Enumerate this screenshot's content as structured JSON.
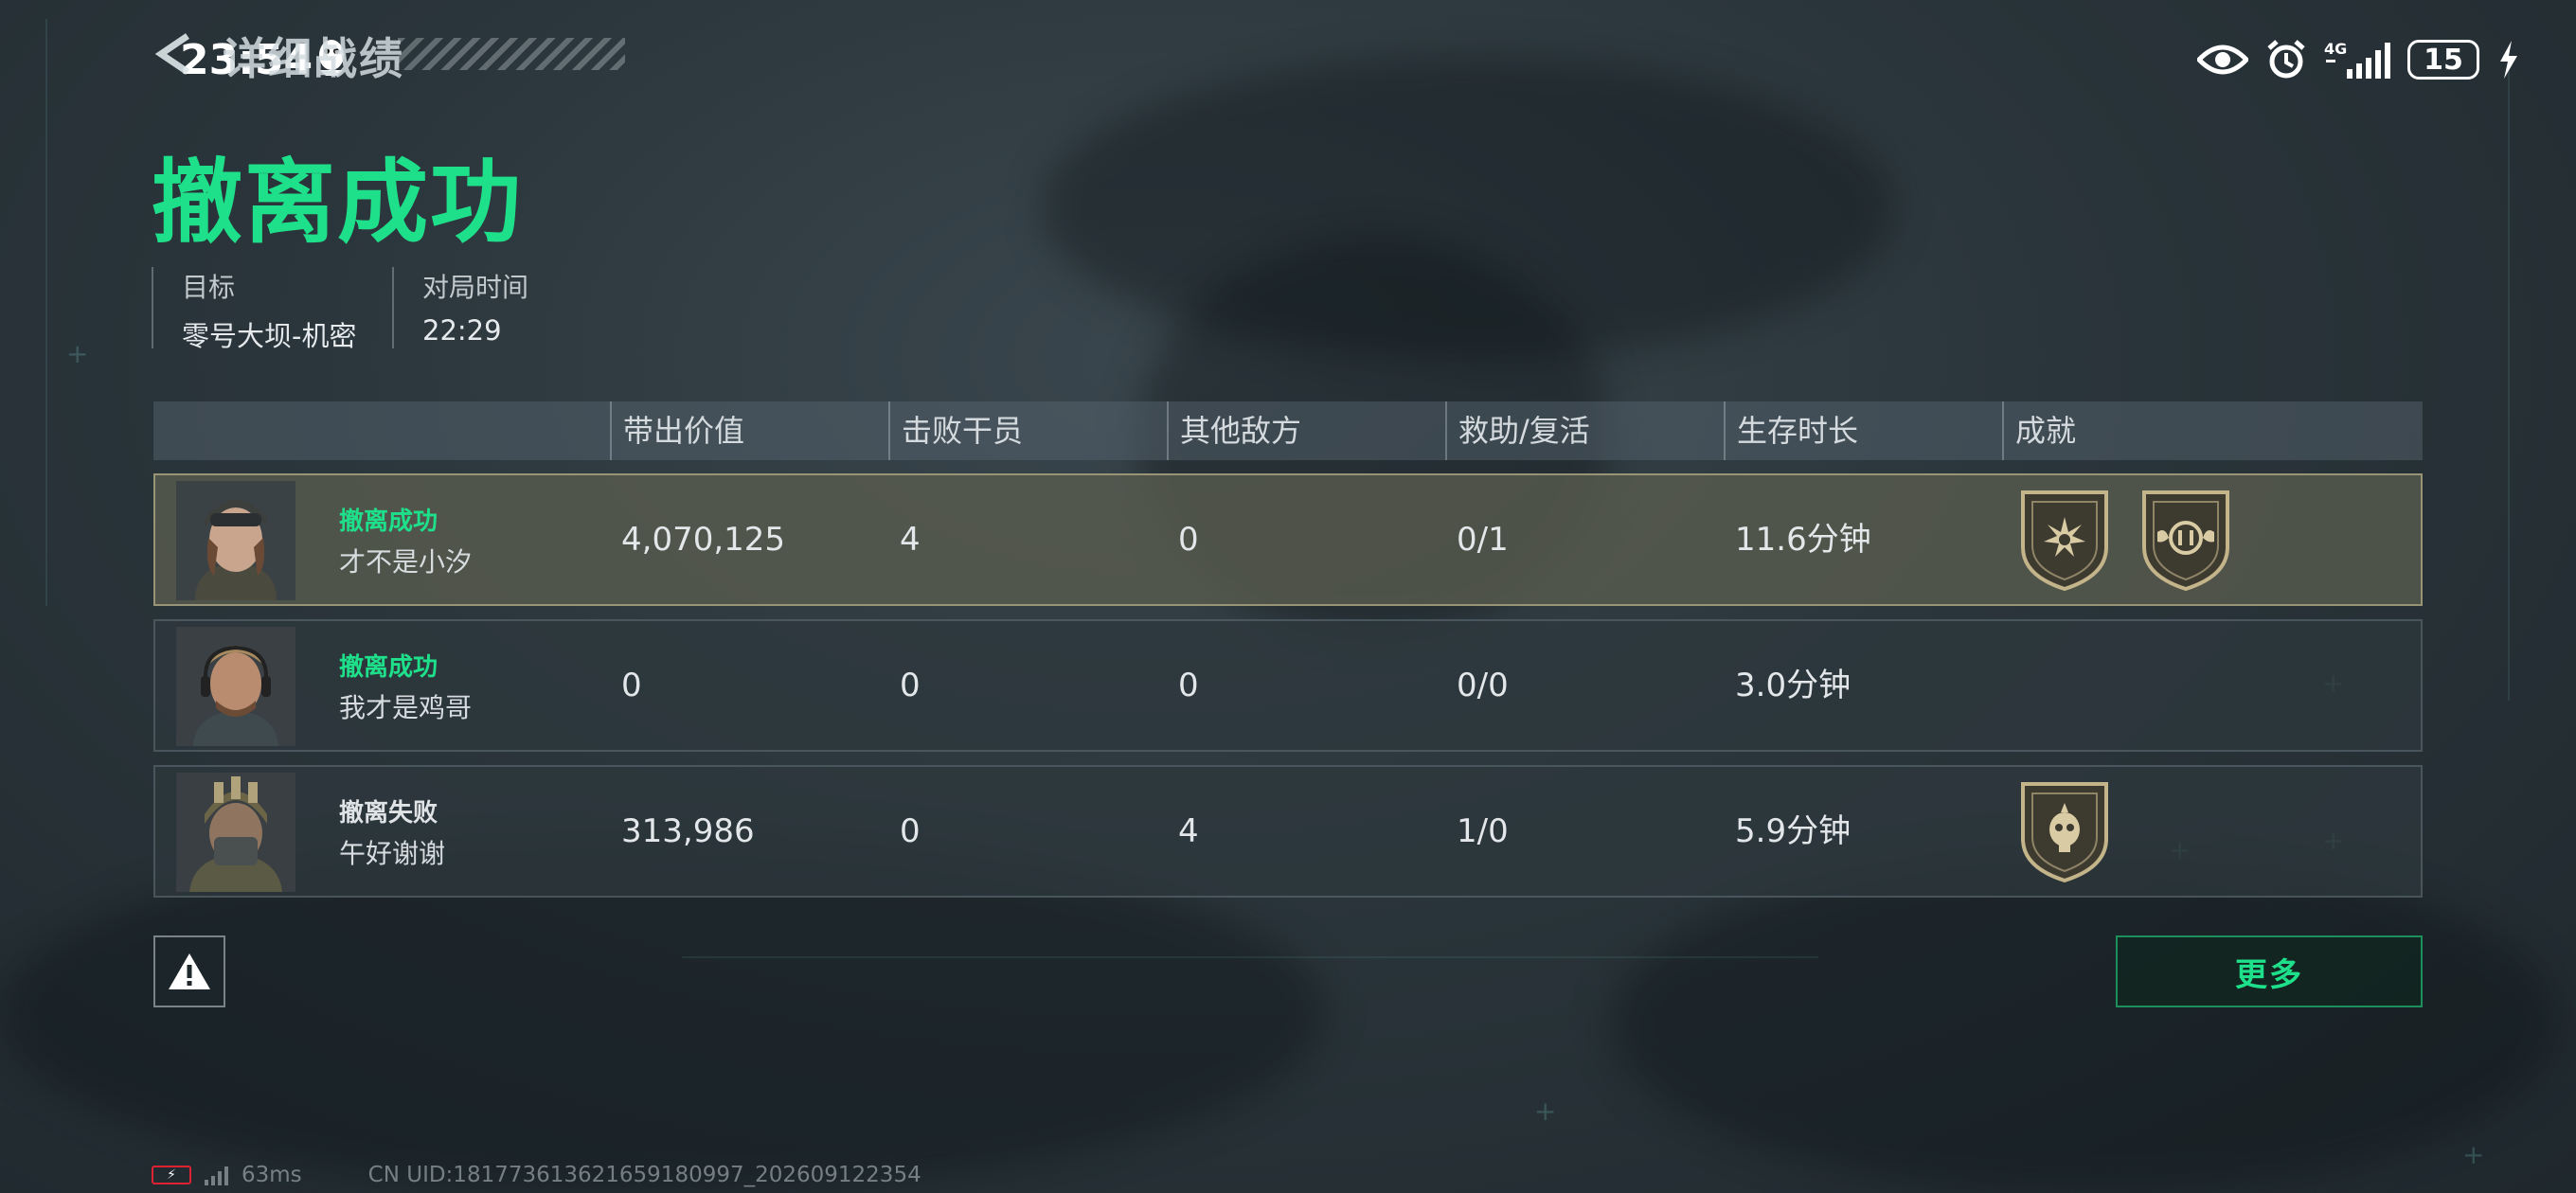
{
  "status_bar": {
    "time": "23:54",
    "battery_level": "15"
  },
  "header": {
    "back_label": "详细战绩",
    "result_title": "撤离成功"
  },
  "info": {
    "target_label": "目标",
    "target_value": "零号大坝-机密",
    "match_time_label": "对局时间",
    "match_time_value": "22:29"
  },
  "table": {
    "columns": [
      "带出价值",
      "击败干员",
      "其他敌方",
      "救助/复活",
      "生存时长",
      "成就"
    ],
    "rows": [
      {
        "status": "撤离成功",
        "status_type": "success",
        "name": "才不是小汐",
        "value": "4,070,125",
        "kills": "4",
        "other_enemies": "0",
        "assist_revive": "0/1",
        "survival": "11.6分钟",
        "badges": [
          "sunburst-badge-icon",
          "winged-coin-badge-icon"
        ],
        "highlight": true
      },
      {
        "status": "撤离成功",
        "status_type": "success",
        "name": "我才是鸡哥",
        "value": "0",
        "kills": "0",
        "other_enemies": "0",
        "assist_revive": "0/0",
        "survival": "3.0分钟",
        "badges": [],
        "highlight": false
      },
      {
        "status": "撤离失败",
        "status_type": "fail",
        "name": "午好谢谢",
        "value": "313,986",
        "kills": "0",
        "other_enemies": "4",
        "assist_revive": "1/0",
        "survival": "5.9分钟",
        "badges": [
          "skull-badge-icon"
        ],
        "highlight": false
      }
    ]
  },
  "actions": {
    "report_icon": "warning-icon",
    "more_label": "更多"
  },
  "footer": {
    "ping": "63ms",
    "uid": "CN UID:18177361362165918099​7_202609122354"
  },
  "colors": {
    "accent_green": "#1fe08a",
    "highlight_row_border": "#aaa582"
  }
}
